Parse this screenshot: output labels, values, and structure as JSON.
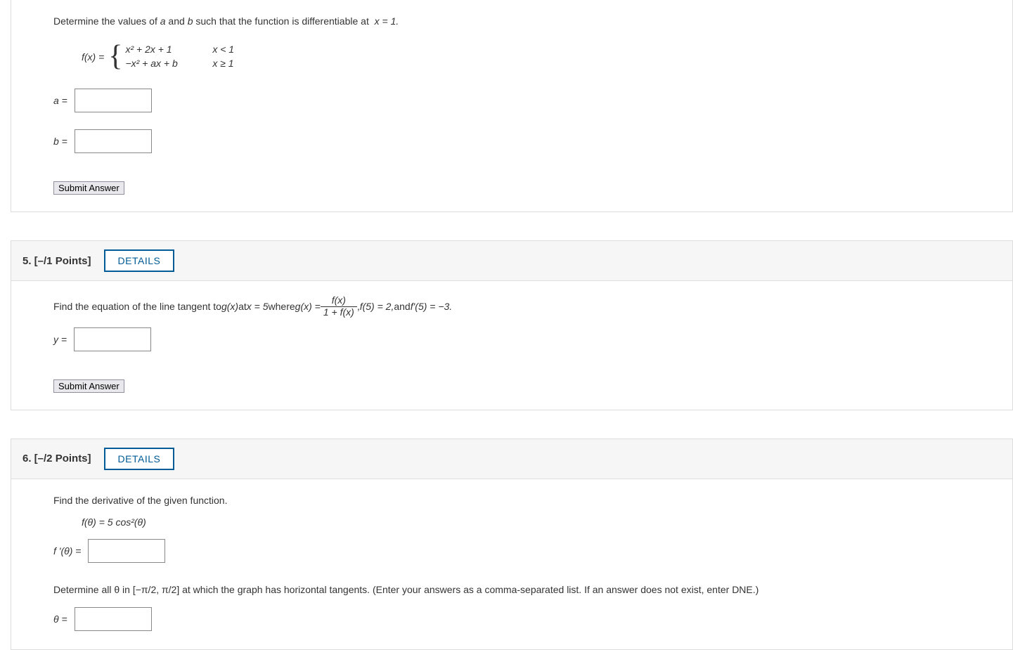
{
  "q4": {
    "prompt_prefix": "Determine the values of ",
    "var_a": "a",
    "mid": " and ",
    "var_b": "b",
    "prompt_suffix": " such that the function is differentiable at ",
    "at": "x = 1.",
    "fx_label": "f(x) = ",
    "row1_expr": "x² + 2x + 1",
    "row1_cond": "x < 1",
    "row2_expr": "−x² + ax + b",
    "row2_cond": "x ≥ 1",
    "a_label": "a = ",
    "b_label": "b = ",
    "submit": "Submit Answer"
  },
  "q5": {
    "header": "5.  [–/1 Points]",
    "details": "DETAILS",
    "prompt_p1": "Find the equation of the line tangent to  ",
    "gx": "g(x)",
    "prompt_p2": "  at  ",
    "xval": "x = 5",
    "prompt_p3": "  where  ",
    "gx_eq": "g(x) = ",
    "frac_num": "f(x)",
    "frac_den": "1 + f(x)",
    "comma": ",   ",
    "f5": "f(5) = 2,",
    "and": "  and  ",
    "fp5": "f'(5) = −3.",
    "y_label": "y = ",
    "submit": "Submit Answer"
  },
  "q6": {
    "header": "6.  [–/2 Points]",
    "details": "DETAILS",
    "prompt1": "Find the derivative of the given function.",
    "func": "f(θ) = 5 cos²(θ)",
    "fp_label": "f '(θ) = ",
    "prompt2": "Determine all θ in [−π/2, π/2] at which the graph has horizontal tangents. (Enter your answers as a comma-separated list. If an answer does not exist, enter DNE.)",
    "theta_label": "θ = "
  }
}
